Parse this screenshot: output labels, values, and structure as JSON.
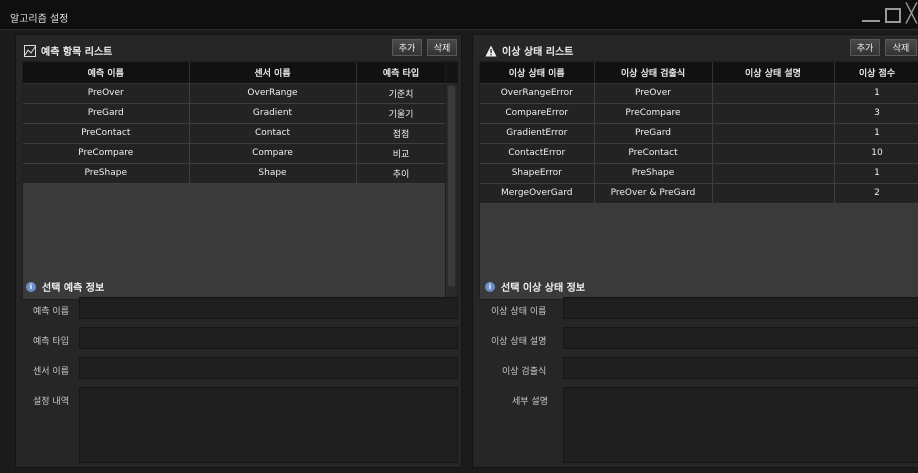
{
  "window": {
    "title": "알고리즘 설정",
    "minimize_icon": "minimize-icon",
    "maximize_icon": "maximize-icon",
    "close_icon": "close-icon"
  },
  "left": {
    "title": "예측 항목 리스트",
    "title_icon": "chart-icon",
    "add_label": "추가",
    "delete_label": "삭제",
    "columns": [
      "예측 이름",
      "센서 이름",
      "예측 타입"
    ],
    "rows": [
      [
        "PreOver",
        "OverRange",
        "기준치"
      ],
      [
        "PreGard",
        "Gradient",
        "기울기"
      ],
      [
        "PreContact",
        "Contact",
        "접점"
      ],
      [
        "PreCompare",
        "Compare",
        "비교"
      ],
      [
        "PreShape",
        "Shape",
        "추이"
      ]
    ],
    "info_title": "선택 예측 정보",
    "info_icon": "info-icon",
    "fields": [
      "예측 이름",
      "예측 타입",
      "센서 이름",
      "설정 내역"
    ]
  },
  "right": {
    "title": "이상 상태 리스트",
    "title_icon": "warning-icon",
    "add_label": "추가",
    "delete_label": "삭제",
    "columns": [
      "이상 상태 이름",
      "이상 상태 검출식",
      "이상 상태 설명",
      "이상 점수"
    ],
    "rows": [
      [
        "OverRangeError",
        "PreOver",
        "",
        "1"
      ],
      [
        "CompareError",
        "PreCompare",
        "",
        "3"
      ],
      [
        "GradientError",
        "PreGard",
        "",
        "1"
      ],
      [
        "ContactError",
        "PreContact",
        "",
        "10"
      ],
      [
        "ShapeError",
        "PreShape",
        "",
        "1"
      ],
      [
        "MergeOverGard",
        "PreOver & PreGard",
        "",
        "2"
      ]
    ],
    "info_title": "선택 이상 상태 정보",
    "info_icon": "info-icon",
    "fields": [
      "이상 상태 이름",
      "이상 상태 설명",
      "이상 검출식",
      "세부 설명"
    ]
  }
}
